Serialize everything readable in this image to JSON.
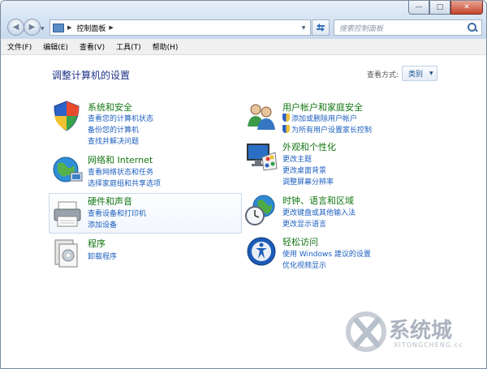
{
  "window": {
    "caption": {
      "min": "—",
      "max": "□",
      "close": "✕"
    },
    "nav": {
      "back": "◀",
      "forward": "▶"
    }
  },
  "address": {
    "path": "控制面板",
    "separator": "▶"
  },
  "search": {
    "placeholder": "搜索控制面板"
  },
  "menubar": [
    "文件(F)",
    "编辑(E)",
    "查看(V)",
    "工具(T)",
    "帮助(H)"
  ],
  "main": {
    "title": "调整计算机的设置",
    "view_label": "查看方式:",
    "view_value": "类别"
  },
  "categories": [
    {
      "title": "系统和安全",
      "links": [
        "查看您的计算机状态",
        "备份您的计算机",
        "查找并解决问题"
      ]
    },
    {
      "title": "网络和 Internet",
      "links": [
        "查看网络状态和任务",
        "选择家庭组和共享选项"
      ]
    },
    {
      "title": "硬件和声音",
      "links": [
        "查看设备和打印机",
        "添加设备"
      ]
    },
    {
      "title": "程序",
      "links": [
        "卸载程序"
      ]
    },
    {
      "title": "用户帐户和家庭安全",
      "links": [
        "添加或删除用户帐户",
        "为所有用户设置家长控制"
      ]
    },
    {
      "title": "外观和个性化",
      "links": [
        "更改主题",
        "更改桌面背景",
        "调整屏幕分辨率"
      ]
    },
    {
      "title": "时钟、语言和区域",
      "links": [
        "更改键盘或其他输入法",
        "更改显示语言"
      ]
    },
    {
      "title": "轻松访问",
      "links": [
        "使用 Windows 建议的设置",
        "优化视频显示"
      ]
    }
  ],
  "watermark": {
    "main": "系统城",
    "sub": "XITONGCHENG.cc"
  }
}
